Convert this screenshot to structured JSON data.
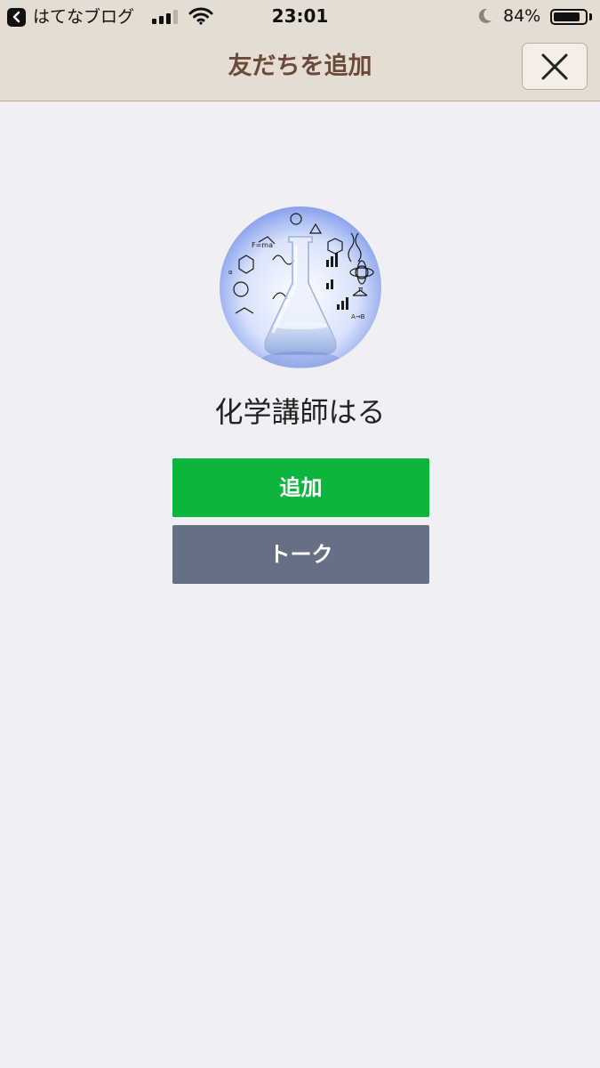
{
  "status_bar": {
    "back_app_label": "はてなブログ",
    "time": "23:01",
    "battery_percent": "84%",
    "battery_level": 0.84,
    "signal_bars": 3,
    "signal_bars_total": 4
  },
  "nav": {
    "title": "友だちを追加",
    "close_icon": "close-icon"
  },
  "profile": {
    "name": "化学講師はる",
    "avatar_icon": "flask-science-avatar"
  },
  "actions": {
    "add_label": "追加",
    "talk_label": "トーク"
  },
  "colors": {
    "header_bg": "#e5ddd2",
    "title_color": "#6a4a3a",
    "page_bg": "#efeff4",
    "add_button": "#0bb53e",
    "talk_button": "#657087"
  }
}
